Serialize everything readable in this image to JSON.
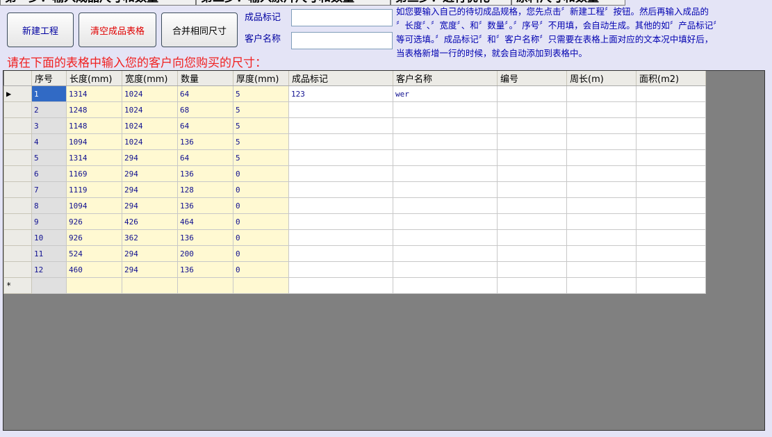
{
  "tabs": [
    "第一步：输入成品尺寸和数量",
    "第二步：输入原片尺寸和数量",
    "第三步：进行优化",
    "原料尺寸和数量"
  ],
  "buttons": {
    "new_project": "新建工程",
    "clear_table": "清空成品表格",
    "merge_same": "合并相同尺寸"
  },
  "fields": {
    "product_mark_label": "成品标记",
    "product_mark_value": "",
    "customer_label": "客户名称",
    "customer_value": ""
  },
  "instructions": [
    "如您要输入自己的待切成品规格，您先点击〞新建工程〞按钮。然后再输入成品的",
    "〞长度〞、〞宽度〞、和〞数量〞。〞序号〞不用填，会自动生成。其他的如〞产品标记〞",
    "等可选填。〞成品标记〞和〞客户名称〞只需要在表格上面对应的文本况中填好后，",
    "当表格新增一行的时候，就会自动添加到表格中。"
  ],
  "hint": "请在下面的表格中输入您的客户向您购买的尺寸：",
  "grid": {
    "columns": [
      "序号",
      "长度(mm)",
      "宽度(mm)",
      "数量",
      "厚度(mm)",
      "成品标记",
      "客户名称",
      "编号",
      "周长(m)",
      "面积(m2)"
    ],
    "current_row_marker": "▶",
    "new_row_marker": "*",
    "rows": [
      [
        "1",
        "1314",
        "1024",
        "64",
        "5",
        "123",
        "wer",
        "",
        "",
        ""
      ],
      [
        "2",
        "1248",
        "1024",
        "68",
        "5",
        "",
        "",
        "",
        "",
        ""
      ],
      [
        "3",
        "1148",
        "1024",
        "64",
        "5",
        "",
        "",
        "",
        "",
        ""
      ],
      [
        "4",
        "1094",
        "1024",
        "136",
        "5",
        "",
        "",
        "",
        "",
        ""
      ],
      [
        "5",
        "1314",
        "294",
        "64",
        "5",
        "",
        "",
        "",
        "",
        ""
      ],
      [
        "6",
        "1169",
        "294",
        "136",
        "0",
        "",
        "",
        "",
        "",
        ""
      ],
      [
        "7",
        "1119",
        "294",
        "128",
        "0",
        "",
        "",
        "",
        "",
        ""
      ],
      [
        "8",
        "1094",
        "294",
        "136",
        "0",
        "",
        "",
        "",
        "",
        ""
      ],
      [
        "9",
        "926",
        "426",
        "464",
        "0",
        "",
        "",
        "",
        "",
        ""
      ],
      [
        "10",
        "926",
        "362",
        "136",
        "0",
        "",
        "",
        "",
        "",
        ""
      ],
      [
        "11",
        "524",
        "294",
        "200",
        "0",
        "",
        "",
        "",
        "",
        ""
      ],
      [
        "12",
        "460",
        "294",
        "136",
        "0",
        "",
        "",
        "",
        "",
        ""
      ]
    ]
  }
}
